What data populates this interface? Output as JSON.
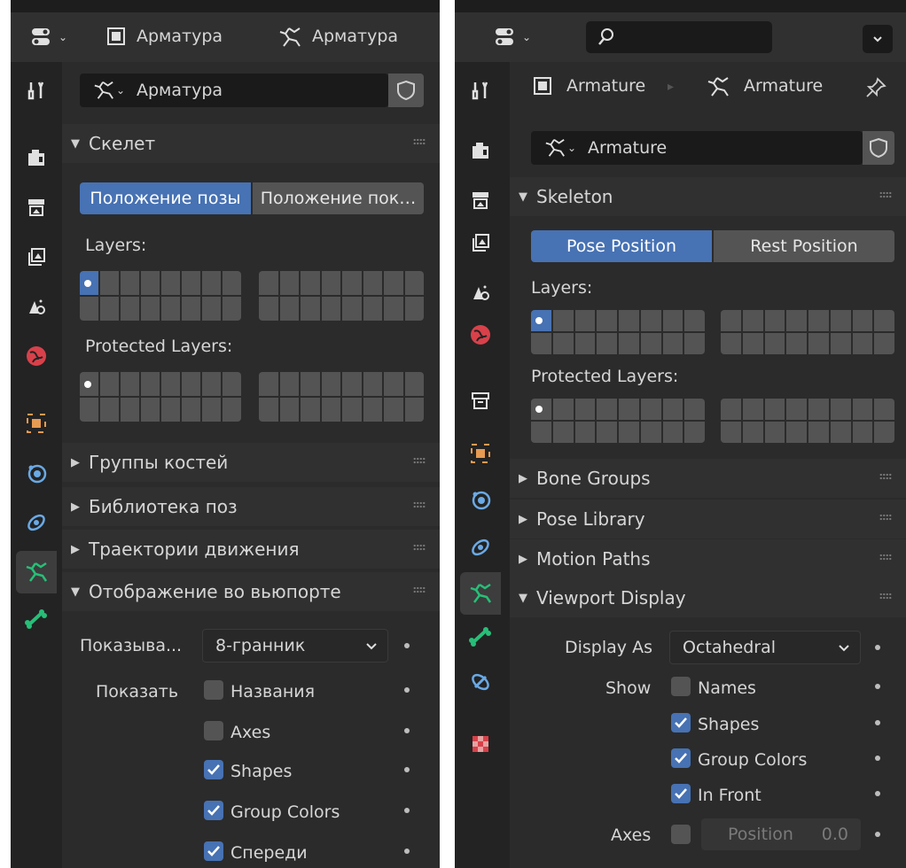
{
  "colors": {
    "accent": "#4772b3",
    "panel": "#2b2b2b",
    "header": "#303030",
    "tab_active": "#3d3d3d",
    "green": "#27bf78",
    "orange": "#e69a52",
    "red": "#d8414a",
    "blue_icon": "#6aa9e5"
  },
  "left": {
    "header": {
      "object_name": "Арматура",
      "data_name": "Арматура"
    },
    "tabs": [
      "tool-icon",
      "render-icon",
      "output-icon",
      "view-layer-icon",
      "scene-icon",
      "world-icon",
      "object-icon",
      "physics-icon",
      "constraints-icon",
      "armature-data-icon",
      "bone-icon"
    ],
    "datablock": {
      "name": "Арматура"
    },
    "skeleton": {
      "title": "Скелет",
      "pose_position": "Положение позы",
      "rest_position": "Положение пок…",
      "layers_label": "Layers:",
      "protected_label": "Protected Layers:"
    },
    "sections": {
      "bone_groups": "Группы костей",
      "pose_library": "Библиотека поз",
      "motion_paths": "Траектории движения",
      "viewport_display": "Отображение во вьюпорте"
    },
    "viewport": {
      "display_as_label": "Показыва...",
      "display_as_value": "8-гранник",
      "show_label": "Показать",
      "names": "Названия",
      "axes": "Axes",
      "shapes": "Shapes",
      "group_colors": "Group Colors",
      "in_front": "Спереди",
      "names_checked": false,
      "axes_checked": false,
      "shapes_checked": true,
      "group_colors_checked": true,
      "in_front_checked": true
    }
  },
  "right": {
    "header": {
      "object_name": "Armature",
      "data_name": "Armature"
    },
    "tabs": [
      "tool-icon",
      "render-icon",
      "output-icon",
      "view-layer-icon",
      "scene-icon",
      "world-icon",
      "collection-icon",
      "object-icon",
      "physics-icon",
      "constraints-icon",
      "armature-data-icon",
      "bone-icon",
      "bone-constraints-icon",
      "texture-icon"
    ],
    "datablock": {
      "name": "Armature"
    },
    "skeleton": {
      "title": "Skeleton",
      "pose_position": "Pose Position",
      "rest_position": "Rest Position",
      "layers_label": "Layers:",
      "protected_label": "Protected Layers:"
    },
    "sections": {
      "bone_groups": "Bone Groups",
      "pose_library": "Pose Library",
      "motion_paths": "Motion Paths",
      "viewport_display": "Viewport Display"
    },
    "viewport": {
      "display_as_label": "Display As",
      "display_as_value": "Octahedral",
      "show_label": "Show",
      "names": "Names",
      "shapes": "Shapes",
      "group_colors": "Group Colors",
      "in_front": "In Front",
      "axes_label": "Axes",
      "position_label": "Position",
      "position_value": "0.0",
      "names_checked": false,
      "shapes_checked": true,
      "group_colors_checked": true,
      "in_front_checked": true,
      "axes_checked": false
    }
  }
}
